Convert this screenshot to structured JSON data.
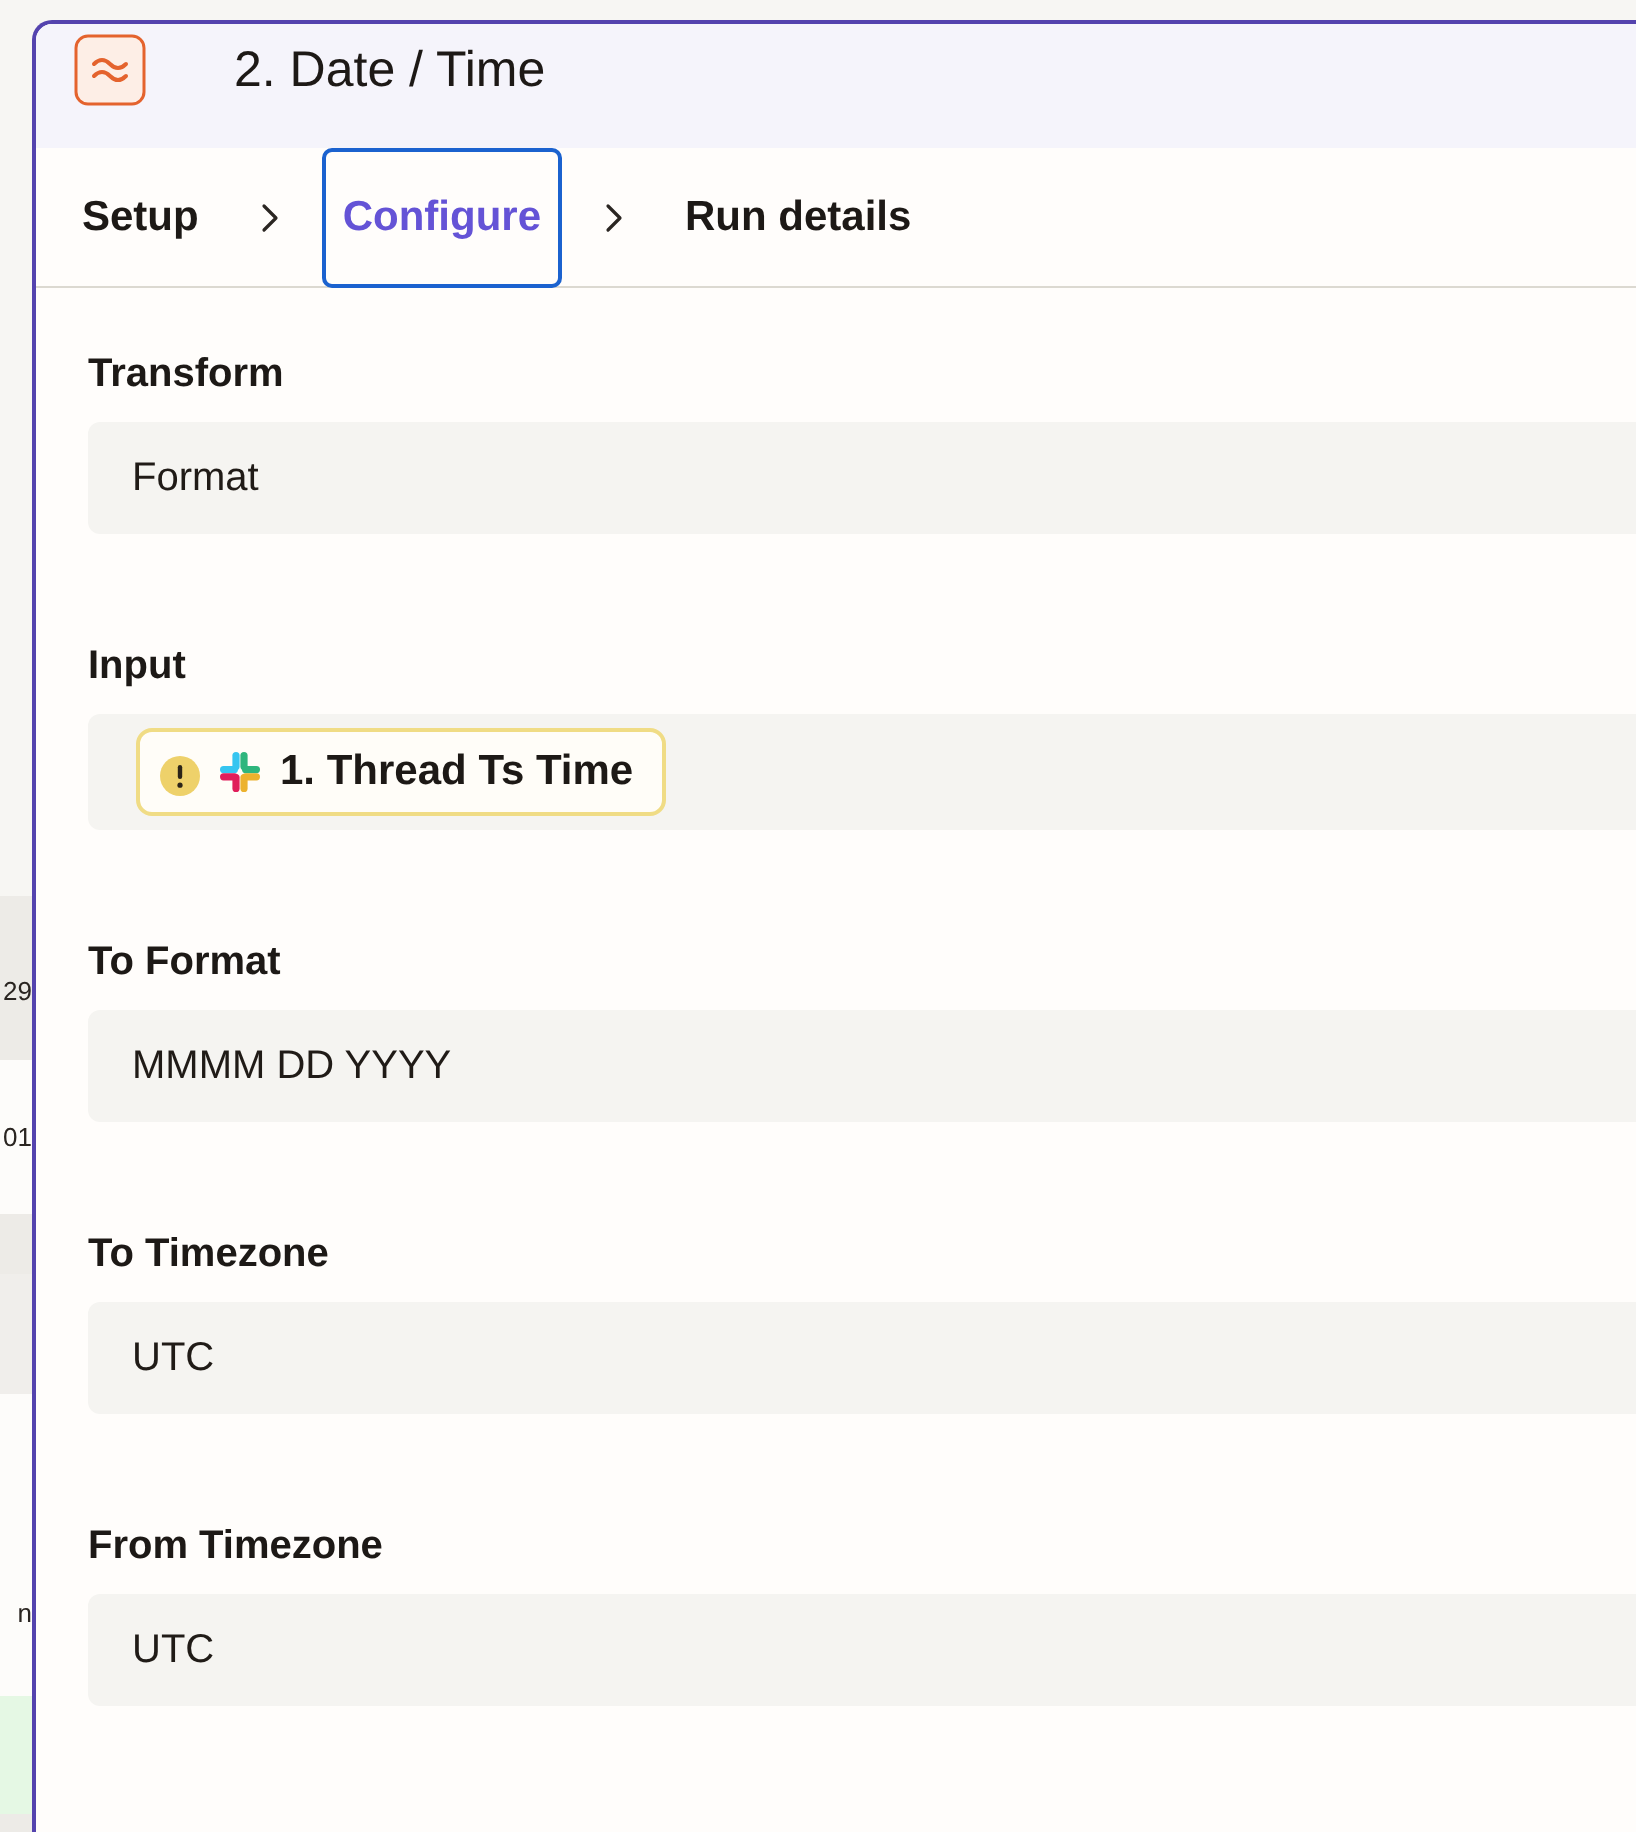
{
  "background_table": {
    "rows": [
      {
        "kind": "shaded",
        "cell": "29"
      },
      {
        "kind": "plain",
        "cell": "01"
      },
      {
        "kind": "shaded"
      },
      {
        "kind": "muted"
      },
      {
        "kind": "plain",
        "cell": "n"
      },
      {
        "kind": "highlighted"
      },
      {
        "kind": "shaded"
      }
    ]
  },
  "header": {
    "title": "2. Date / Time"
  },
  "steps": [
    {
      "label": "Setup",
      "selected": false
    },
    {
      "label": "Configure",
      "selected": true
    },
    {
      "label": "Run details",
      "selected": false
    }
  ],
  "fields": [
    {
      "label": "Transform",
      "kind": "text",
      "value": "Format"
    },
    {
      "label": "Input",
      "kind": "token",
      "token": {
        "label": "1. Thread Ts Time",
        "warning": true
      }
    },
    {
      "label": "To Format",
      "kind": "text",
      "value": "MMMM DD YYYY"
    },
    {
      "label": "To Timezone",
      "kind": "text",
      "value": "UTC"
    },
    {
      "label": "From Timezone",
      "kind": "text",
      "value": "UTC"
    }
  ]
}
